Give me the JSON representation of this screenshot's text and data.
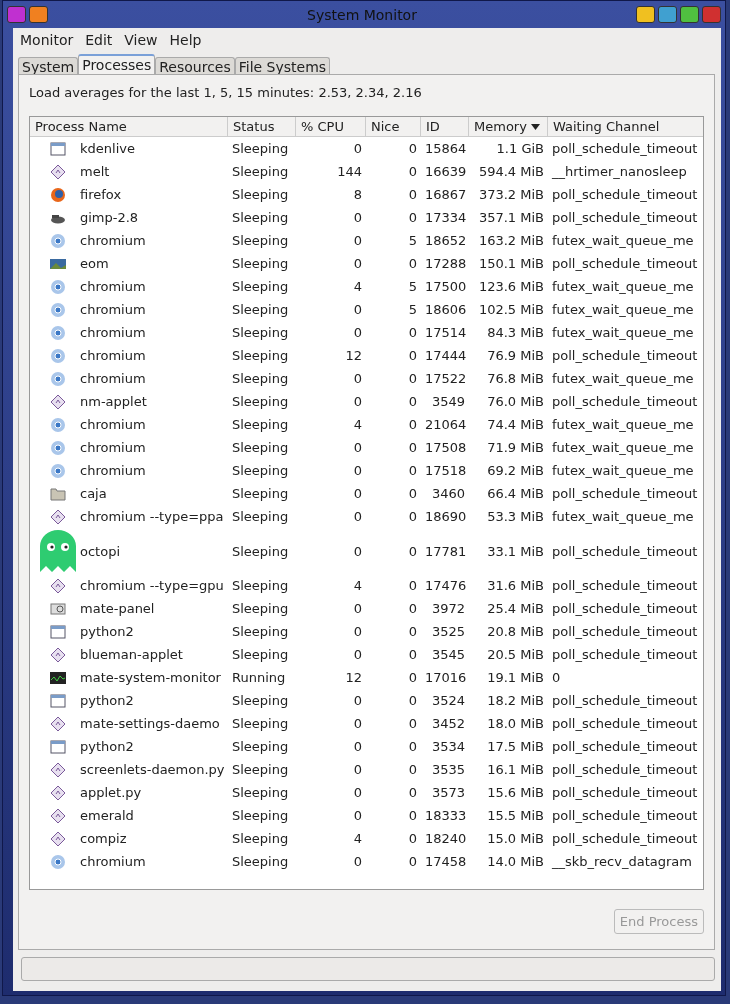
{
  "window": {
    "title": "System Monitor"
  },
  "menu": [
    "Monitor",
    "Edit",
    "View",
    "Help"
  ],
  "tabs": [
    {
      "label": "System",
      "selected": false
    },
    {
      "label": "Processes",
      "selected": true
    },
    {
      "label": "Resources",
      "selected": false
    },
    {
      "label": "File Systems",
      "selected": false
    }
  ],
  "load_averages": "Load averages for the last 1, 5, 15 minutes: 2.53, 2.34, 2.16",
  "table": {
    "columns": [
      {
        "label": "Process Name",
        "sorted": false
      },
      {
        "label": "Status",
        "sorted": false
      },
      {
        "label": "% CPU",
        "sorted": false
      },
      {
        "label": "Nice",
        "sorted": false
      },
      {
        "label": "ID",
        "sorted": false
      },
      {
        "label": "Memory",
        "sorted": true
      },
      {
        "label": "Waiting Channel",
        "sorted": false
      }
    ],
    "rows": [
      {
        "kind": "window",
        "name": "kdenlive",
        "status": "Sleeping",
        "cpu": "0",
        "nice": "0",
        "id": "15864",
        "memory": "1.1 GiB",
        "channel": "poll_schedule_timeout"
      },
      {
        "kind": "diamond",
        "name": "melt",
        "status": "Sleeping",
        "cpu": "144",
        "nice": "0",
        "id": "16639",
        "memory": "594.4 MiB",
        "channel": "__hrtimer_nanosleep"
      },
      {
        "kind": "firefox",
        "name": "firefox",
        "status": "Sleeping",
        "cpu": "8",
        "nice": "0",
        "id": "16867",
        "memory": "373.2 MiB",
        "channel": "poll_schedule_timeout"
      },
      {
        "kind": "gimp",
        "name": "gimp-2.8",
        "status": "Sleeping",
        "cpu": "0",
        "nice": "0",
        "id": "17334",
        "memory": "357.1 MiB",
        "channel": "poll_schedule_timeout"
      },
      {
        "kind": "chromium",
        "name": "chromium",
        "status": "Sleeping",
        "cpu": "0",
        "nice": "5",
        "id": "18652",
        "memory": "163.2 MiB",
        "channel": "futex_wait_queue_me"
      },
      {
        "kind": "photo",
        "name": "eom",
        "status": "Sleeping",
        "cpu": "0",
        "nice": "0",
        "id": "17288",
        "memory": "150.1 MiB",
        "channel": "poll_schedule_timeout"
      },
      {
        "kind": "chromium",
        "name": "chromium",
        "status": "Sleeping",
        "cpu": "4",
        "nice": "5",
        "id": "17500",
        "memory": "123.6 MiB",
        "channel": "futex_wait_queue_me"
      },
      {
        "kind": "chromium",
        "name": "chromium",
        "status": "Sleeping",
        "cpu": "0",
        "nice": "5",
        "id": "18606",
        "memory": "102.5 MiB",
        "channel": "futex_wait_queue_me"
      },
      {
        "kind": "chromium",
        "name": "chromium",
        "status": "Sleeping",
        "cpu": "0",
        "nice": "0",
        "id": "17514",
        "memory": "84.3 MiB",
        "channel": "futex_wait_queue_me"
      },
      {
        "kind": "chromium",
        "name": "chromium",
        "status": "Sleeping",
        "cpu": "12",
        "nice": "0",
        "id": "17444",
        "memory": "76.9 MiB",
        "channel": "poll_schedule_timeout"
      },
      {
        "kind": "chromium",
        "name": "chromium",
        "status": "Sleeping",
        "cpu": "0",
        "nice": "0",
        "id": "17522",
        "memory": "76.8 MiB",
        "channel": "futex_wait_queue_me"
      },
      {
        "kind": "diamond",
        "name": "nm-applet",
        "status": "Sleeping",
        "cpu": "0",
        "nice": "0",
        "id": "3549",
        "memory": "76.0 MiB",
        "channel": "poll_schedule_timeout"
      },
      {
        "kind": "chromium",
        "name": "chromium",
        "status": "Sleeping",
        "cpu": "4",
        "nice": "0",
        "id": "21064",
        "memory": "74.4 MiB",
        "channel": "futex_wait_queue_me"
      },
      {
        "kind": "chromium",
        "name": "chromium",
        "status": "Sleeping",
        "cpu": "0",
        "nice": "0",
        "id": "17508",
        "memory": "71.9 MiB",
        "channel": "futex_wait_queue_me"
      },
      {
        "kind": "chromium",
        "name": "chromium",
        "status": "Sleeping",
        "cpu": "0",
        "nice": "0",
        "id": "17518",
        "memory": "69.2 MiB",
        "channel": "futex_wait_queue_me"
      },
      {
        "kind": "folder",
        "name": "caja",
        "status": "Sleeping",
        "cpu": "0",
        "nice": "0",
        "id": "3460",
        "memory": "66.4 MiB",
        "channel": "poll_schedule_timeout"
      },
      {
        "kind": "diamond",
        "name": "chromium --type=ppa",
        "status": "Sleeping",
        "cpu": "0",
        "nice": "0",
        "id": "18690",
        "memory": "53.3 MiB",
        "channel": "futex_wait_queue_me"
      },
      {
        "kind": "ghost",
        "name": "octopi",
        "status": "Sleeping",
        "cpu": "0",
        "nice": "0",
        "id": "17781",
        "memory": "33.1 MiB",
        "channel": "poll_schedule_timeout"
      },
      {
        "kind": "diamond",
        "name": "chromium --type=gpu",
        "status": "Sleeping",
        "cpu": "4",
        "nice": "0",
        "id": "17476",
        "memory": "31.6 MiB",
        "channel": "poll_schedule_timeout"
      },
      {
        "kind": "panel",
        "name": "mate-panel",
        "status": "Sleeping",
        "cpu": "0",
        "nice": "0",
        "id": "3972",
        "memory": "25.4 MiB",
        "channel": "poll_schedule_timeout"
      },
      {
        "kind": "window",
        "name": "python2",
        "status": "Sleeping",
        "cpu": "0",
        "nice": "0",
        "id": "3525",
        "memory": "20.8 MiB",
        "channel": "poll_schedule_timeout"
      },
      {
        "kind": "diamond",
        "name": "blueman-applet",
        "status": "Sleeping",
        "cpu": "0",
        "nice": "0",
        "id": "3545",
        "memory": "20.5 MiB",
        "channel": "poll_schedule_timeout"
      },
      {
        "kind": "monitor",
        "name": "mate-system-monitor",
        "status": "Running",
        "cpu": "12",
        "nice": "0",
        "id": "17016",
        "memory": "19.1 MiB",
        "channel": "0"
      },
      {
        "kind": "window",
        "name": "python2",
        "status": "Sleeping",
        "cpu": "0",
        "nice": "0",
        "id": "3524",
        "memory": "18.2 MiB",
        "channel": "poll_schedule_timeout"
      },
      {
        "kind": "diamond",
        "name": "mate-settings-daemo",
        "status": "Sleeping",
        "cpu": "0",
        "nice": "0",
        "id": "3452",
        "memory": "18.0 MiB",
        "channel": "poll_schedule_timeout"
      },
      {
        "kind": "window",
        "name": "python2",
        "status": "Sleeping",
        "cpu": "0",
        "nice": "0",
        "id": "3534",
        "memory": "17.5 MiB",
        "channel": "poll_schedule_timeout"
      },
      {
        "kind": "diamond",
        "name": "screenlets-daemon.py",
        "status": "Sleeping",
        "cpu": "0",
        "nice": "0",
        "id": "3535",
        "memory": "16.1 MiB",
        "channel": "poll_schedule_timeout"
      },
      {
        "kind": "diamond",
        "name": "applet.py",
        "status": "Sleeping",
        "cpu": "0",
        "nice": "0",
        "id": "3573",
        "memory": "15.6 MiB",
        "channel": "poll_schedule_timeout"
      },
      {
        "kind": "diamond",
        "name": "emerald",
        "status": "Sleeping",
        "cpu": "0",
        "nice": "0",
        "id": "18333",
        "memory": "15.5 MiB",
        "channel": "poll_schedule_timeout"
      },
      {
        "kind": "diamond",
        "name": "compiz",
        "status": "Sleeping",
        "cpu": "4",
        "nice": "0",
        "id": "18240",
        "memory": "15.0 MiB",
        "channel": "poll_schedule_timeout"
      },
      {
        "kind": "chromium",
        "name": "chromium",
        "status": "Sleeping",
        "cpu": "0",
        "nice": "0",
        "id": "17458",
        "memory": "14.0 MiB",
        "channel": "__skb_recv_datagram"
      }
    ]
  },
  "end_button": {
    "label": "End Process",
    "disabled": true
  }
}
